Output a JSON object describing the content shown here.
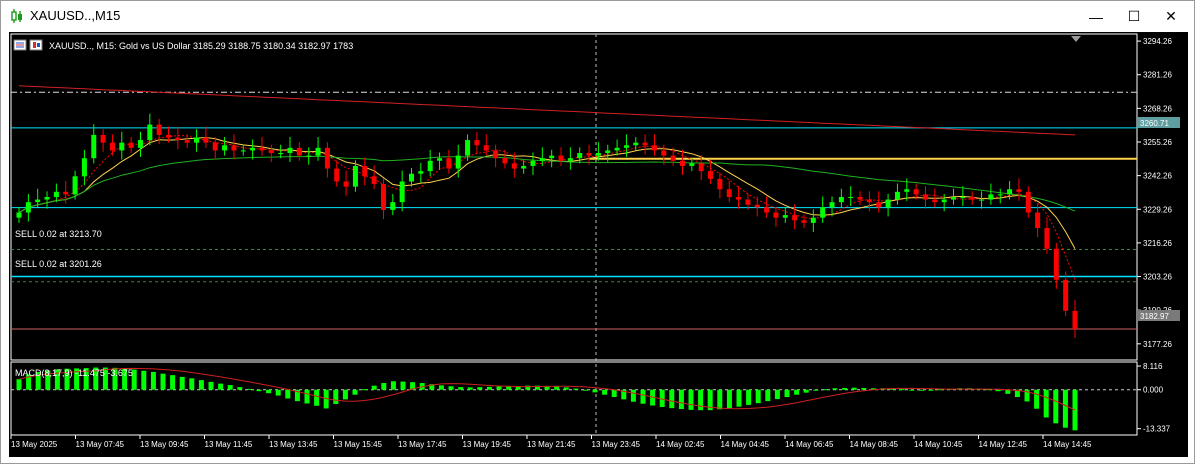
{
  "window": {
    "title": "XAUUSD..,M15",
    "minimize_glyph": "—",
    "maximize_glyph": "☐",
    "close_glyph": "✕"
  },
  "chart_header": {
    "text": "XAUUSD.., M15:  Gold vs US Dollar  3185.29 3188.75 3180.34 3182.97  1783"
  },
  "trades": [
    {
      "label": "SELL 0.02 at 3213.70",
      "price": 3213.7
    },
    {
      "label": "SELL 0.02 at 3201.26",
      "price": 3201.26
    }
  ],
  "price_labels": {
    "highlight_level": "3260.71",
    "current_price": "3182.97"
  },
  "macd_header": "MACD(8,17,9) -11.475 -3.675",
  "colors": {
    "background": "#000000",
    "bull": "#00ff00",
    "bear": "#ff0000",
    "hline_cyan": "#00e5ff",
    "trendline": "#ffd24d",
    "ma_slow": "#d02020",
    "ma_mid": "#20b020",
    "ma_fast": "#ffd24d"
  },
  "chart_data": {
    "type": "candlestick",
    "price_axis_ticks": [
      "3294.26",
      "3281.26",
      "3268.26",
      "3255.26",
      "3242.26",
      "3229.26",
      "3216.26",
      "3203.26",
      "3190.26",
      "3177.26"
    ],
    "price_range": [
      3171,
      3297
    ],
    "horizontal_levels": [
      3274.5,
      3260.71,
      3248.8,
      3229.9,
      3203.26
    ],
    "current_price": 3182.97,
    "macd_axis_ticks": [
      "8.116",
      "0.000",
      "-13.337"
    ],
    "macd_range": [
      -15.5,
      9.5
    ],
    "time_labels": [
      "13 May 2025",
      "13 May 07:45",
      "13 May 09:45",
      "13 May 11:45",
      "13 May 13:45",
      "13 May 15:45",
      "13 May 17:45",
      "13 May 19:45",
      "13 May 21:45",
      "13 May 23:45",
      "14 May 02:45",
      "14 May 04:45",
      "14 May 06:45",
      "14 May 08:45",
      "14 May 10:45",
      "14 May 12:45",
      "14 May 14:45"
    ],
    "closes": [
      3228,
      3232,
      3233,
      3234,
      3236,
      3235,
      3242,
      3249,
      3258,
      3255,
      3252,
      3255,
      3253,
      3256,
      3262,
      3258,
      3257,
      3256,
      3255,
      3257,
      3255,
      3252,
      3254,
      3252,
      3252,
      3253,
      3252,
      3251,
      3251,
      3253,
      3250,
      3250,
      3253,
      3245,
      3240,
      3238,
      3246,
      3242,
      3239,
      3229,
      3232,
      3240,
      3243,
      3244,
      3248,
      3249,
      3245,
      3250,
      3256,
      3254,
      3252,
      3249,
      3247,
      3245,
      3246,
      3248,
      3249,
      3250,
      3248,
      3249,
      3251,
      3250,
      3251,
      3252,
      3253,
      3254,
      3255,
      3254,
      3252,
      3250,
      3248,
      3246,
      3247,
      3244,
      3241,
      3237,
      3234,
      3233,
      3231,
      3230,
      3228,
      3226,
      3227,
      3225,
      3224,
      3226,
      3230,
      3232,
      3234,
      3234,
      3233,
      3232,
      3230,
      3233,
      3236,
      3237,
      3235,
      3233,
      3232,
      3233,
      3234,
      3234,
      3233,
      3233,
      3235,
      3235,
      3237,
      3236,
      3228,
      3222,
      3214,
      3202,
      3190,
      3183
    ],
    "macd_hist": [
      3.6,
      5.2,
      6.1,
      6.6,
      7.0,
      7.2,
      7.3,
      7.4,
      7.6,
      7.6,
      7.5,
      7.2,
      6.9,
      6.5,
      6.1,
      5.5,
      5.0,
      4.4,
      3.9,
      3.3,
      2.7,
      2.1,
      1.6,
      0.9,
      0.3,
      -0.5,
      -1.2,
      -2.0,
      -3.0,
      -3.9,
      -4.7,
      -5.5,
      -6.4,
      -4.9,
      -3.3,
      -1.7,
      0.2,
      1.4,
      2.3,
      2.9,
      2.8,
      2.6,
      2.3,
      1.9,
      1.5,
      1.2,
      0.9,
      0.8,
      0.9,
      1.0,
      1.1,
      1.2,
      1.3,
      1.4,
      1.4,
      1.3,
      1.1,
      0.8,
      0.4,
      -0.2,
      -0.9,
      -1.7,
      -2.5,
      -3.3,
      -4.1,
      -4.8,
      -5.4,
      -5.9,
      -6.3,
      -6.6,
      -6.9,
      -7.0,
      -7.0,
      -6.7,
      -6.3,
      -5.8,
      -5.2,
      -4.6,
      -3.9,
      -3.2,
      -2.5,
      -1.7,
      -1.0,
      -0.3,
      0.2,
      0.5,
      0.6,
      0.7,
      0.6,
      0.5,
      0.5,
      0.4,
      0.2,
      0.0,
      -0.1,
      0.0,
      0.2,
      0.3,
      0.5,
      0.5,
      0.4,
      0.2,
      -0.5,
      -1.4,
      -2.5,
      -4.0,
      -6.5,
      -9.5,
      -11.5,
      -13.0,
      -13.9
    ]
  }
}
